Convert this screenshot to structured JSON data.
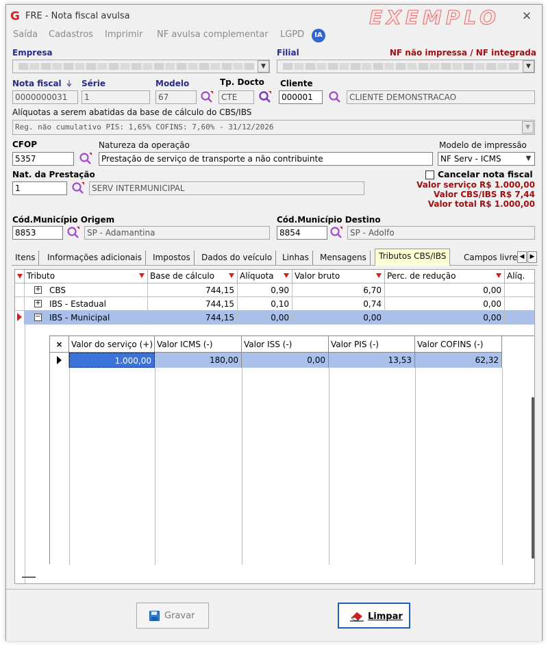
{
  "window": {
    "app_icon": "G",
    "title": "FRE - Nota fiscal avulsa",
    "watermark": "EXEMPLO",
    "close_glyph": "✕"
  },
  "menu": [
    "Saída",
    "Cadastros",
    "Imprimir",
    "NF avulsa complementar",
    "LGPD"
  ],
  "ia_badge": "IA",
  "form": {
    "empresa_label": "Empresa",
    "filial_label": "Filial",
    "status_text": "NF não impressa / NF integrada",
    "nota_fiscal_label": "Nota fiscal",
    "nota_fiscal_value": "0000000031",
    "serie_label": "Série",
    "serie_value": "1",
    "modelo_label": "Modelo",
    "modelo_value": "67",
    "tp_docto_label": "Tp. Docto",
    "tp_docto_value": "CTE",
    "cliente_label": "Cliente",
    "cliente_code": "000001",
    "cliente_name": "CLIENTE DEMONSTRACAO",
    "aliquotas_label": "Alíquotas a serem abatidas da base de cálculo do CBS/IBS",
    "aliquotas_value": "Reg. não cumulativo PIS: 1,65% COFINS: 7,60% - 31/12/2026",
    "cfop_label": "CFOP",
    "cfop_value": "5357",
    "natureza_label": "Natureza da operação",
    "natureza_value": "Prestação de serviço de transporte a não contribuinte",
    "modelo_impressao_label": "Modelo de impressão",
    "modelo_impressao_value": "NF Serv - ICMS",
    "nat_prestacao_label": "Nat. da Prestação",
    "nat_prestacao_code": "1",
    "nat_prestacao_desc": "SERV INTERMUNICIPAL",
    "cancelar_label": "Cancelar nota fiscal",
    "valor_servico": "Valor serviço R$ 1.000,00",
    "valor_cbs_ibs": "Valor CBS/IBS R$ 7,44",
    "valor_total": "Valor total R$ 1.000,00",
    "mun_origem_label": "Cód.Município Origem",
    "mun_origem_code": "8853",
    "mun_origem_name": "SP - Adamantina",
    "mun_destino_label": "Cód.Município Destino",
    "mun_destino_code": "8854",
    "mun_destino_name": "SP - Adolfo"
  },
  "tabs": [
    "Itens",
    "Informações adicionais",
    "Impostos",
    "Dados do veículo",
    "Linhas",
    "Mensagens",
    "Tributos CBS/IBS",
    "Campos livre"
  ],
  "grid": {
    "headers": [
      "Tributo",
      "Base de cálculo",
      "Alíquota",
      "Valor bruto",
      "Perc. de redução",
      "Alíq."
    ],
    "rows": [
      {
        "expander": "+",
        "tributo": "CBS",
        "base": "744,15",
        "aliquota": "0,90",
        "bruto": "6,70",
        "reducao": "0,00"
      },
      {
        "expander": "+",
        "tributo": "IBS - Estadual",
        "base": "744,15",
        "aliquota": "0,10",
        "bruto": "0,74",
        "reducao": "0,00"
      },
      {
        "expander": "−",
        "tributo": "IBS - Municipal",
        "base": "744,15",
        "aliquota": "0,00",
        "bruto": "0,00",
        "reducao": "0,00"
      }
    ],
    "detail_headers": [
      "×",
      "Valor do serviço (+)",
      "Valor ICMS (-)",
      "Valor ISS (-)",
      "Valor PIS (-)",
      "Valor COFINS (-)"
    ],
    "detail_row": [
      "1.000,00",
      "180,00",
      "0,00",
      "13,53",
      "62,32"
    ]
  },
  "buttons": {
    "gravar": "Gravar",
    "limpar": "Limpar"
  }
}
